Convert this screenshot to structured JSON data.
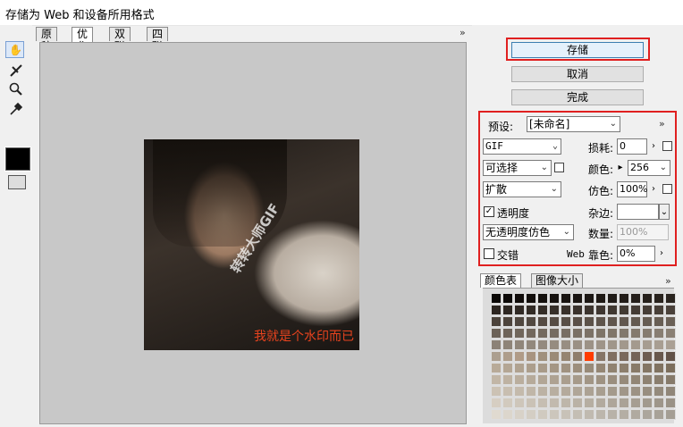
{
  "window": {
    "title": "存储为 Web 和设备所用格式"
  },
  "view_tabs": [
    {
      "label": "原稿",
      "active": false
    },
    {
      "label": "优化",
      "active": true
    },
    {
      "label": "双联",
      "active": false
    },
    {
      "label": "四联",
      "active": false
    }
  ],
  "tools": [
    "hand-tool-icon",
    "slice-select-tool-icon",
    "zoom-tool-icon",
    "eyedropper-tool-icon"
  ],
  "eyedropper_color": "#000000",
  "image": {
    "watermark_diagonal": "转转大师GIF",
    "watermark_corner": "我就是个水印而已"
  },
  "buttons": {
    "save": "存储",
    "cancel": "取消",
    "done": "完成"
  },
  "settings": {
    "preset_label": "预设:",
    "preset_value": "[未命名]",
    "format": "GIF",
    "lossy_label": "损耗:",
    "lossy_value": "0",
    "reduction": "可选择",
    "colors_label": "颜色:",
    "colors_value": "256",
    "dither_algo": "扩散",
    "dither_label": "仿色:",
    "dither_value": "100%",
    "transparency_label": "透明度",
    "transparency_checked": true,
    "matte_label": "杂边:",
    "matte_value": "",
    "transparency_dither": "无透明度仿色",
    "amount_label": "数量:",
    "amount_value": "100%",
    "interlaced_label": "交错",
    "interlaced_checked": false,
    "web_snap_prefix": "Web",
    "web_snap_label": "靠色:",
    "web_snap_value": "0%"
  },
  "panel_tabs": [
    {
      "label": "颜色表",
      "active": true
    },
    {
      "label": "图像大小",
      "active": false
    }
  ],
  "palette": {
    "columns": 16,
    "selected_color": "#ff3c00",
    "rows": [
      [
        "#0b0806",
        "#0d0a08",
        "#100c0a",
        "#120e0b",
        "#14100d",
        "#16120f",
        "#181310",
        "#1a1512",
        "#1c1714",
        "#1e1915",
        "#201b17",
        "#221c18",
        "#241e1a",
        "#26201b",
        "#28221d",
        "#2a241f"
      ],
      [
        "#2c2520",
        "#2e2722",
        "#302924",
        "#322b25",
        "#342d27",
        "#362f29",
        "#38302a",
        "#3a322c",
        "#3c342e",
        "#3e3630",
        "#403831",
        "#423a33",
        "#443b35",
        "#463d36",
        "#483f38",
        "#4a413a"
      ],
      [
        "#4c433b",
        "#4e453d",
        "#50473f",
        "#524941",
        "#544a42",
        "#564c44",
        "#584e46",
        "#5a5048",
        "#5c5249",
        "#5e544b",
        "#60564d",
        "#62584f",
        "#645a51",
        "#665c52",
        "#685e54",
        "#6a6056"
      ],
      [
        "#6c6258",
        "#6e645a",
        "#70665b",
        "#72685d",
        "#746a5f",
        "#766c61",
        "#786e63",
        "#7a7065",
        "#7c7267",
        "#7e7468",
        "#80766a",
        "#82786c",
        "#847a6e",
        "#867c70",
        "#887e72",
        "#8a8074"
      ],
      [
        "#8c8276",
        "#8e8478",
        "#90867a",
        "#92887c",
        "#948a7e",
        "#968c80",
        "#988e82",
        "#9a9084",
        "#9c9286",
        "#9e9488",
        "#a0968a",
        "#a2988c",
        "#a49a8e",
        "#a69c90",
        "#a89e92",
        "#aaa094"
      ],
      [
        "#ac9f8f",
        "#ae9d8b",
        "#b09b87",
        "#a89480",
        "#a0907c",
        "#9b8a76",
        "#958471",
        "#8f7e6c",
        "#ff3c00",
        "#867567",
        "#806f61",
        "#7a695c",
        "#746357",
        "#6e5d52",
        "#68584d",
        "#625248"
      ],
      [
        "#b8aa98",
        "#b4a694",
        "#b0a290",
        "#ac9e8c",
        "#a89a88",
        "#a49684",
        "#a09280",
        "#9c8e7c",
        "#988a78",
        "#948674",
        "#908270",
        "#8c7e6c",
        "#887a68",
        "#847664",
        "#807260",
        "#7c6e5c"
      ],
      [
        "#c2b6a6",
        "#beb2a2",
        "#baae9e",
        "#b6aa9a",
        "#b2a696",
        "#aea292",
        "#aa9e8e",
        "#a69a8a",
        "#a29686",
        "#9e9282",
        "#9a8e7e",
        "#968a7a",
        "#928676",
        "#8e8272",
        "#8a7e6e",
        "#867a6a"
      ],
      [
        "#ccc2b4",
        "#c8beb0",
        "#c4baac",
        "#c0b6a8",
        "#bcb2a4",
        "#b8aea0",
        "#b4aa9c",
        "#b0a698",
        "#aca294",
        "#a89e90",
        "#a49a8c",
        "#a09688",
        "#9c9284",
        "#988e80",
        "#948a7c",
        "#908678"
      ],
      [
        "#d6cec2",
        "#d2cabe",
        "#cec6ba",
        "#cac2b6",
        "#c6beb2",
        "#c2baae",
        "#beb6aa",
        "#bab2a6",
        "#b6aea2",
        "#b2aa9e",
        "#aea69a",
        "#aaa296",
        "#a69e92",
        "#a29a8e",
        "#9e968a",
        "#9a9286"
      ],
      [
        "#e0dad0",
        "#dcd6cc",
        "#d8d2c8",
        "#d4cec4",
        "#d0cac0",
        "#ccc6bc",
        "#c8c2b8",
        "#c4beb4",
        "#c0bab0",
        "#bcb6ac",
        "#b8b2a8",
        "#b4aea4",
        "#b0aaa0",
        "#aca69c",
        "#a8a298",
        "#a49e94"
      ]
    ]
  }
}
